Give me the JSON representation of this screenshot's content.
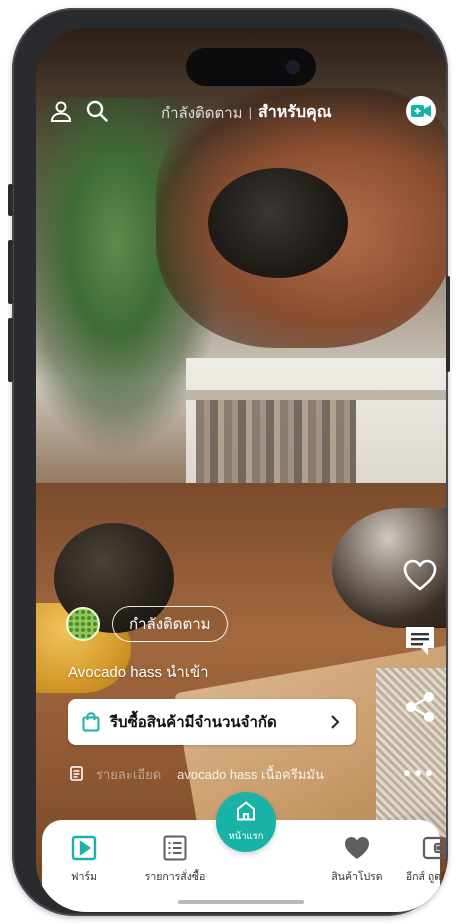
{
  "colors": {
    "accent": "#18b3a6",
    "frame": "#2a2b2e",
    "white": "#ffffff",
    "nav_text": "#333333",
    "nav_icon": "#5e5e5e"
  },
  "header": {
    "profile_icon": "person-icon",
    "search_icon": "search-icon",
    "tab_following": "กำลังติดตาม",
    "separator": "|",
    "tab_for_you": "สำหรับคุณ",
    "live_icon": "video-camera-icon"
  },
  "post": {
    "follow_label": "กำลังติดตาม",
    "caption": "Avocado hass นำเข้า",
    "promo_text": "รีบซื้อสินค้ามีจำนวนจำกัด",
    "promo_icon": "shopping-bag-icon",
    "desc_icon": "document-icon",
    "desc_label": "รายละเอียด",
    "desc_text": "avocado hass เนื้อครีมมัน"
  },
  "actions": {
    "like_icon": "heart-icon",
    "comment_icon": "comment-icon",
    "share_icon": "share-icon",
    "more_icon": "more-dots-icon"
  },
  "nav": {
    "items": [
      {
        "label": "ฟาร์ม",
        "icon": "play-box-icon"
      },
      {
        "label": "รายการสั่งซื้อ",
        "icon": "list-icon"
      },
      {
        "label": "สินค้าโปรด",
        "icon": "heart-icon"
      },
      {
        "label": "อีกส์ ถูดสิเพย์",
        "icon": "wallet-icon"
      }
    ],
    "home_label": "หน้าแรก",
    "home_icon": "home-icon"
  }
}
